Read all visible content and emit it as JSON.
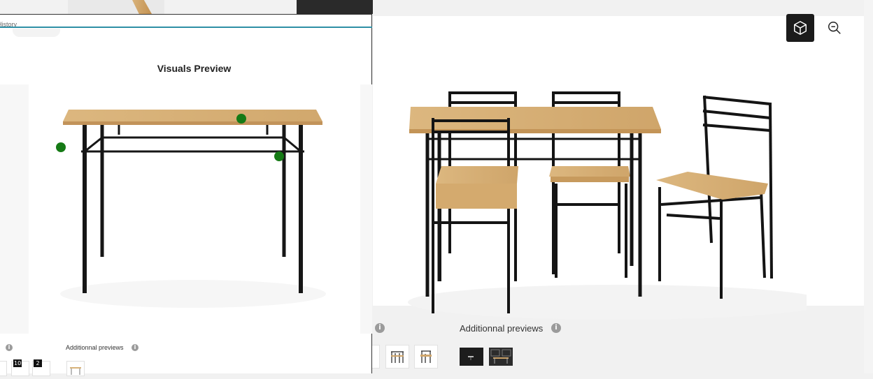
{
  "left_window": {
    "history_tab": "History",
    "visuals_preview_title": "Visuals Preview",
    "additional_previews_label": "Additionnal previews",
    "info_glyph": "i",
    "thumb_badges": [
      "10",
      "2"
    ]
  },
  "right_window": {
    "additional_previews_label": "Additionnal previews",
    "info_glyph": "i",
    "toolbar": {
      "view_3d_icon": "cube-icon",
      "zoom_out_icon": "zoom-out-icon"
    }
  },
  "colors": {
    "accent_teal": "#2e8fa5",
    "hotspot_green": "#157a15",
    "wood": "#d9b47c",
    "metal": "#1a1a1a"
  }
}
